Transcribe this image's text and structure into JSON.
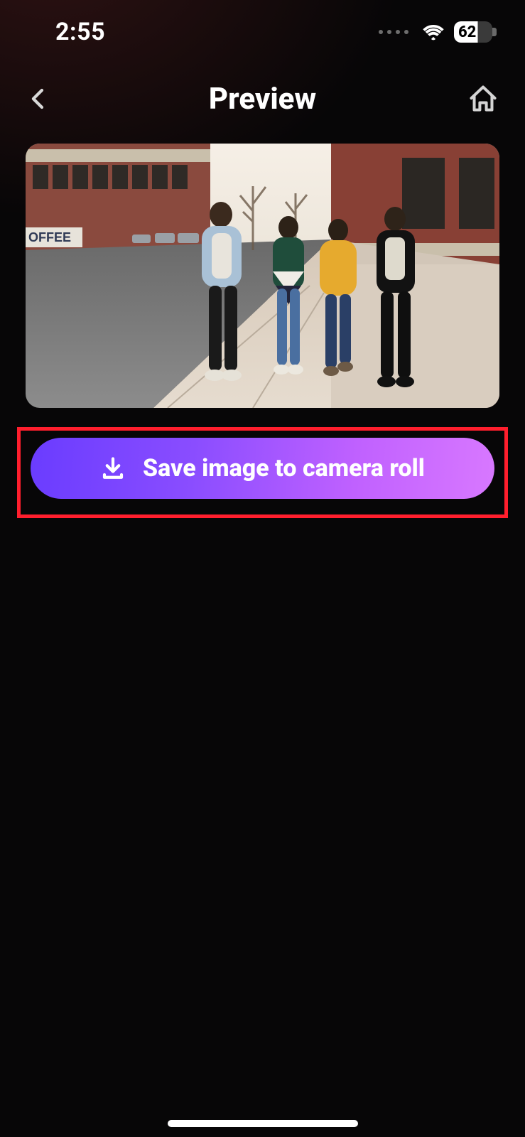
{
  "status": {
    "time": "2:55",
    "battery": "62"
  },
  "header": {
    "title": "Preview"
  },
  "actions": {
    "save_label": "Save image to camera roll"
  },
  "icons": {
    "back": "chevron-left-icon",
    "home": "home-icon",
    "download": "download-icon",
    "wifi": "wifi-icon",
    "battery": "battery-icon"
  },
  "preview": {
    "description": "Four friends walking down a city sidewalk next to a red brick building",
    "visible_text": "OFFEE"
  }
}
